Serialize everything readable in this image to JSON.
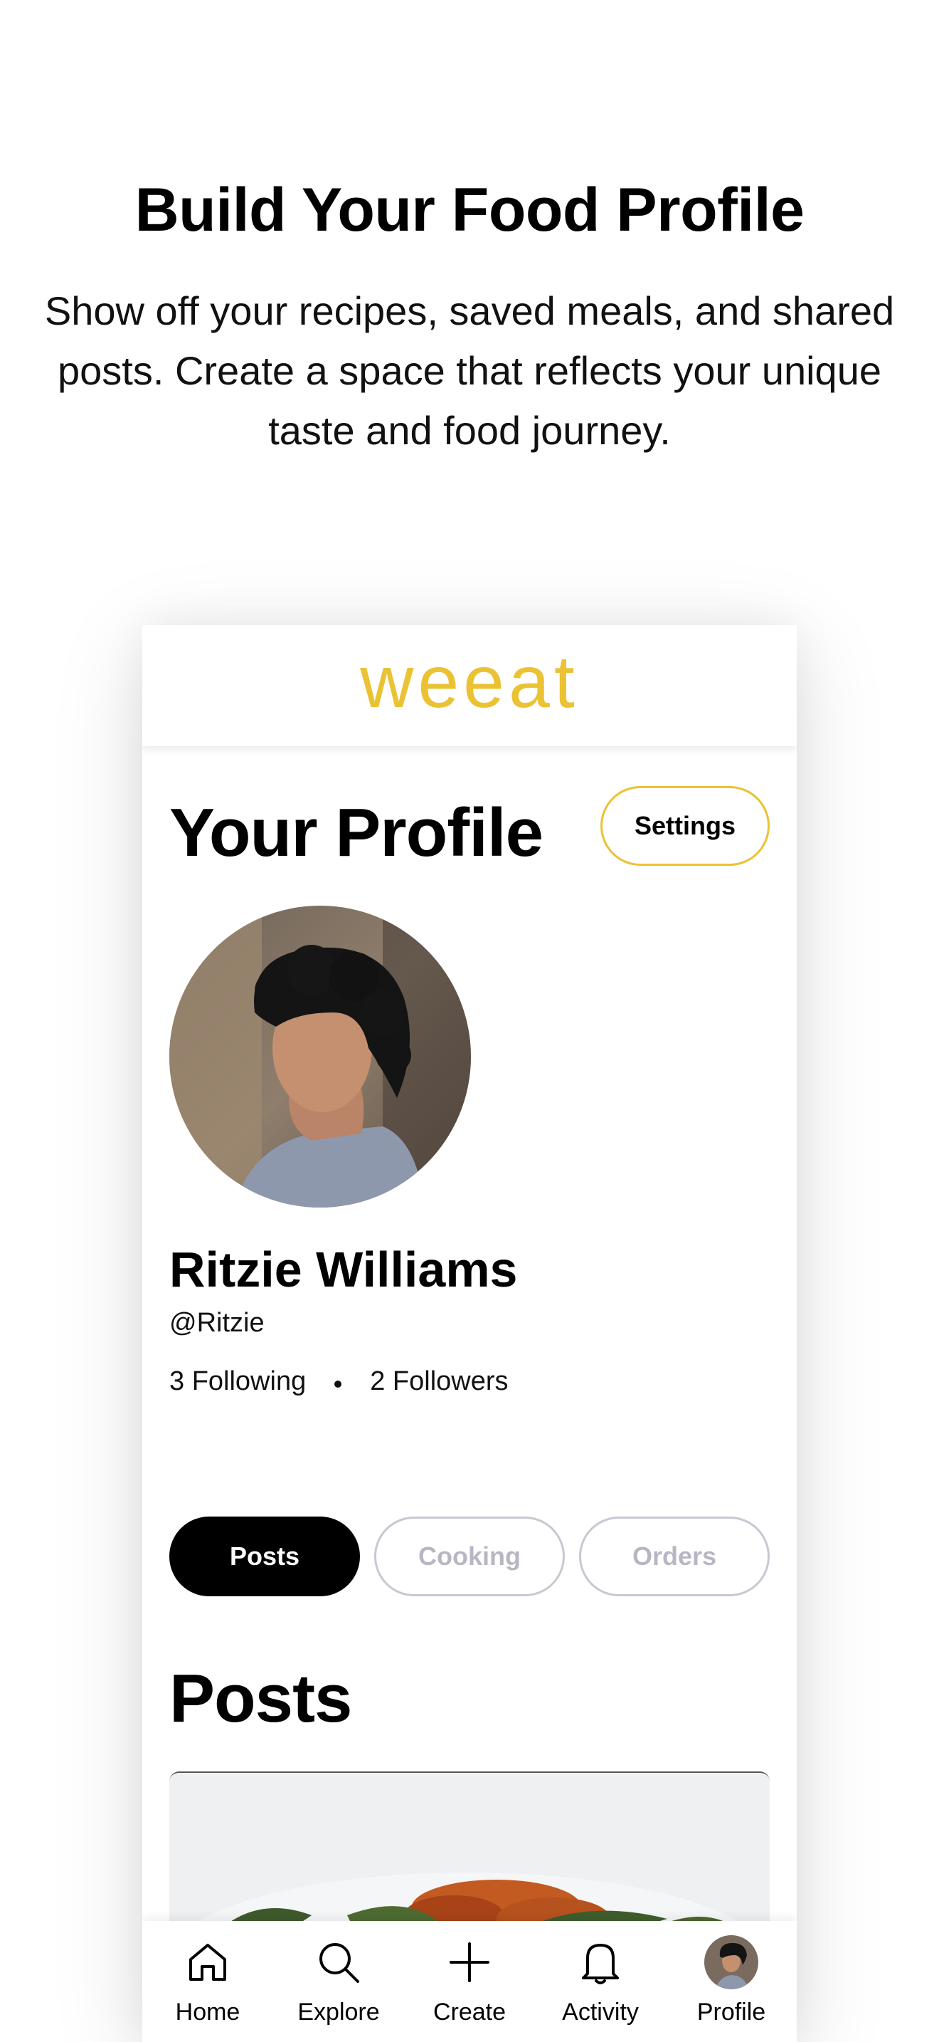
{
  "promo": {
    "title": "Build Your Food Profile",
    "description": "Show off your recipes, saved meals, and shared posts. Create a space that reflects your unique taste and food journey."
  },
  "app": {
    "logo": "weeat",
    "accent_color": "#EBC233"
  },
  "profile": {
    "title": "Your Profile",
    "settings_label": "Settings",
    "name": "Ritzie Williams",
    "handle": "@Ritzie",
    "following": "3 Following",
    "followers": "2 Followers"
  },
  "tabs": [
    {
      "label": "Posts",
      "active": true
    },
    {
      "label": "Cooking",
      "active": false
    },
    {
      "label": "Orders",
      "active": false
    }
  ],
  "posts": {
    "heading": "Posts"
  },
  "nav": [
    {
      "label": "Home",
      "icon": "home-icon"
    },
    {
      "label": "Explore",
      "icon": "search-icon"
    },
    {
      "label": "Create",
      "icon": "plus-icon"
    },
    {
      "label": "Activity",
      "icon": "bell-icon"
    },
    {
      "label": "Profile",
      "icon": "avatar"
    }
  ]
}
